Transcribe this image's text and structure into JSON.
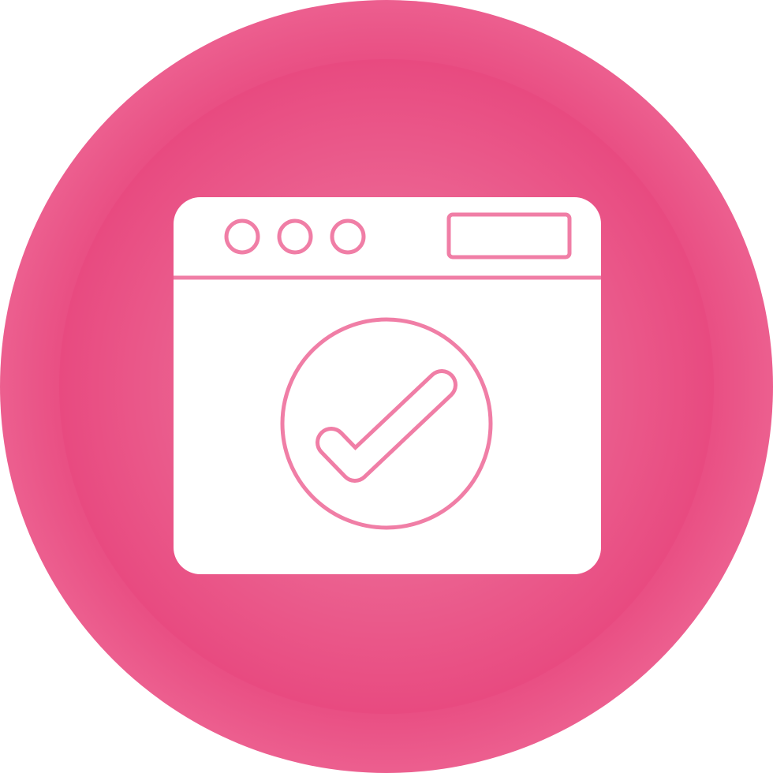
{
  "icon": {
    "name": "browser-window-check-icon",
    "colors": {
      "outer_ring_edge": "#ec5f8f",
      "outer_ring_center": "#e84a80",
      "inner_disc_center": "#f081a6",
      "inner_disc_edge": "#e84a80",
      "glyph_fill": "#ffffff",
      "glyph_stroke": "#f07ea6"
    },
    "window_dots": 3
  }
}
